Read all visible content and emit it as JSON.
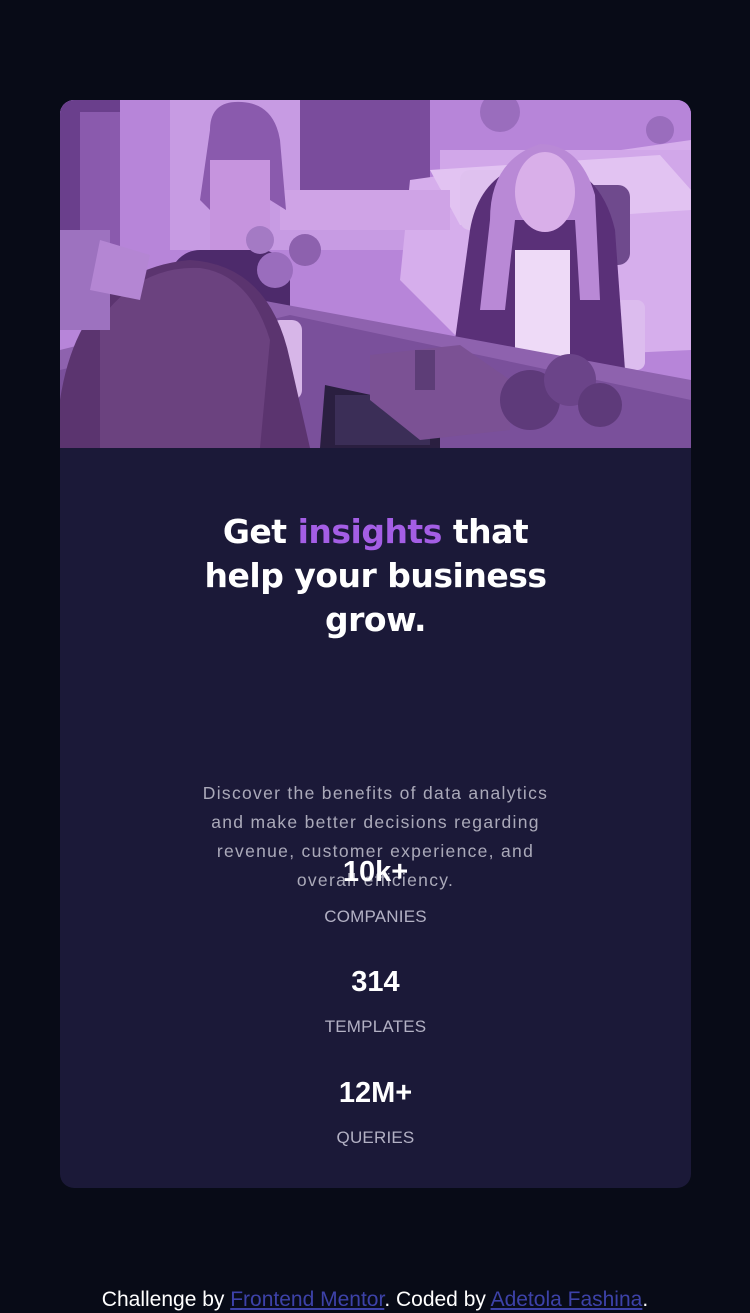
{
  "card": {
    "headline": {
      "part1": "Get ",
      "accent": "insights",
      "part2": " that help your business grow."
    },
    "description": "Discover the benefits of data analytics and make better decisions regarding revenue, customer experience, and overall efficiency.",
    "stats": [
      {
        "value": "10k+",
        "label": "COMPANIES"
      },
      {
        "value": "314",
        "label": "TEMPLATES"
      },
      {
        "value": "12M+",
        "label": "QUERIES"
      }
    ]
  },
  "attribution": {
    "prefix": "Challenge by ",
    "link1": "Frontend Mentor",
    "middle": ". Coded by ",
    "link2": "Adetola Fashina",
    "suffix": "."
  },
  "colors": {
    "page_background": "#080b17",
    "card_background": "#1b1938",
    "accent": "#a45ee5",
    "link": "#3d42a8"
  }
}
